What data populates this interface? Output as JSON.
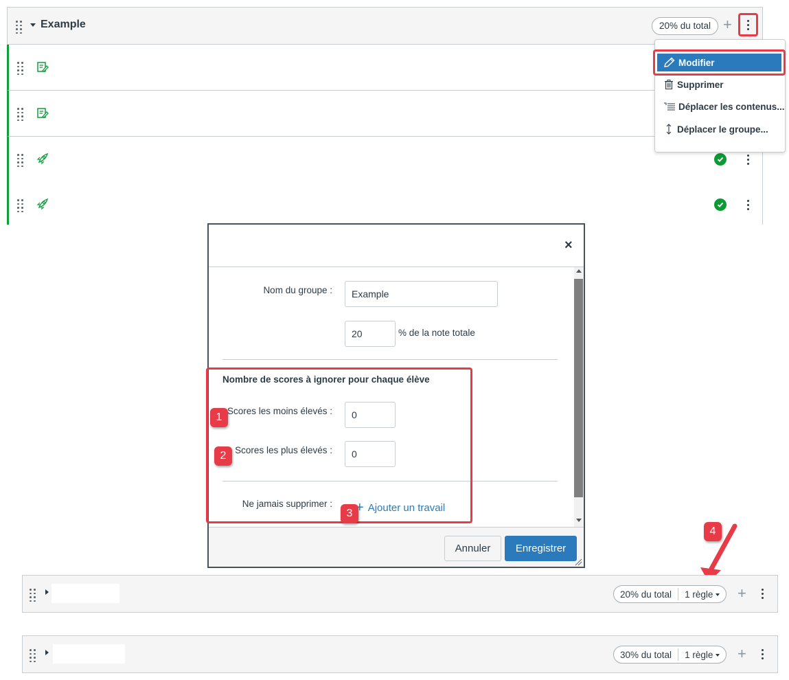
{
  "top_group": {
    "title": "Example",
    "weight_label": "20% du total",
    "rows": [
      {
        "icon": "assignment-icon",
        "status": ""
      },
      {
        "icon": "assignment-icon",
        "status": ""
      },
      {
        "icon": "quiz-rocket-icon",
        "status": "published"
      },
      {
        "icon": "quiz-rocket-icon",
        "status": "published"
      }
    ]
  },
  "menu": {
    "items": [
      {
        "label": "Modifier",
        "icon": "pencil-icon",
        "active": true
      },
      {
        "label": "Supprimer",
        "icon": "trash-icon"
      },
      {
        "label": "Déplacer les contenus...",
        "icon": "move-contents-icon"
      },
      {
        "label": "Déplacer le groupe...",
        "icon": "move-vertical-icon"
      }
    ]
  },
  "dialog": {
    "close_label": "×",
    "group_name_label": "Nom du groupe :",
    "group_name_value": "Example",
    "weight_value": "20",
    "weight_suffix": "% de la note totale",
    "drop_section_title": "Nombre de scores à ignorer pour chaque élève",
    "lowest_label": "Scores les moins élevés :",
    "lowest_value": "0",
    "highest_label": "Scores les plus élevés :",
    "highest_value": "0",
    "never_drop_label": "Ne jamais supprimer :",
    "add_assignment_label": "Ajouter un travail",
    "cancel_label": "Annuler",
    "save_label": "Enregistrer"
  },
  "callouts": [
    "1",
    "2",
    "3",
    "4"
  ],
  "lower_groups": [
    {
      "weight_label": "20% du total",
      "rules_label": "1 règle"
    },
    {
      "weight_label": "30% du total",
      "rules_label": "1 règle"
    }
  ],
  "colors": {
    "accent": "#2b7abc",
    "highlight": "#e73b48",
    "published": "#0b9a34",
    "row_border": "#0f9e3a"
  }
}
